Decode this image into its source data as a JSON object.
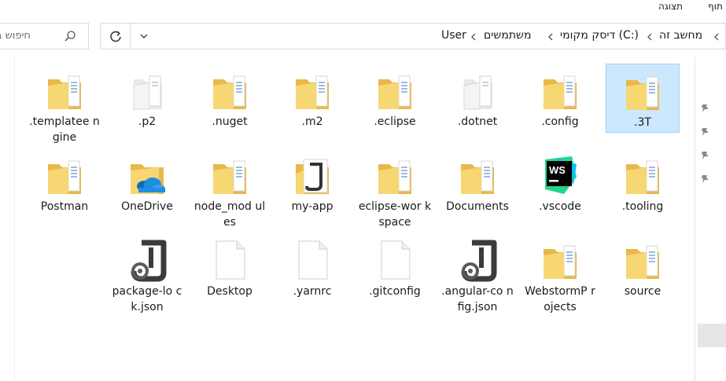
{
  "ribbon": {
    "menu_1": "תצוגה",
    "menu_2": "תוף"
  },
  "address": {
    "crumbs": [
      "מחשב זה",
      "דיסק מקומי (C:)",
      "משתמשים",
      "User"
    ]
  },
  "search": {
    "placeholder": "חיפוש ב"
  },
  "rows": [
    [
      {
        "name": ".3T",
        "icon": "folder-icon",
        "selected": true
      },
      {
        "name": ".config",
        "icon": "folder-icon"
      },
      {
        "name": ".dotnet",
        "icon": "folder-light-icon"
      },
      {
        "name": ".eclipse",
        "icon": "folder-icon"
      },
      {
        "name": ".m2",
        "icon": "folder-icon"
      },
      {
        "name": ".nuget",
        "icon": "folder-icon"
      },
      {
        "name": ".p2",
        "icon": "folder-light-icon"
      },
      {
        "name": ".templatee ngine",
        "icon": "folder-icon"
      }
    ],
    [
      {
        "name": ".tooling",
        "icon": "folder-icon"
      },
      {
        "name": ".vscode",
        "icon": "webstorm-icon"
      },
      {
        "name": "Documents",
        "icon": "folder-icon"
      },
      {
        "name": "eclipse-wor kspace",
        "icon": "folder-icon"
      },
      {
        "name": "my-app",
        "icon": "folder-app-icon"
      },
      {
        "name": "node_mod ules",
        "icon": "folder-icon"
      },
      {
        "name": "OneDrive",
        "icon": "onedrive-folder-icon"
      },
      {
        "name": "Postman",
        "icon": "folder-icon"
      }
    ],
    [
      {
        "name": "source",
        "icon": "folder-icon"
      },
      {
        "name": "WebstormP rojects",
        "icon": "folder-icon"
      },
      {
        "name": ".angular-co nfig.json",
        "icon": "json-app-icon"
      },
      {
        "name": ".gitconfig",
        "icon": "file-icon"
      },
      {
        "name": ".yarnrc",
        "icon": "file-icon"
      },
      {
        "name": "Desktop",
        "icon": "file-icon"
      },
      {
        "name": "package-lo ck.json",
        "icon": "json-app-icon"
      }
    ]
  ],
  "colors": {
    "folder": "#f7d674",
    "folder_dark": "#e8b84a",
    "selection": "#cce8ff",
    "selection_border": "#99d1ff"
  }
}
